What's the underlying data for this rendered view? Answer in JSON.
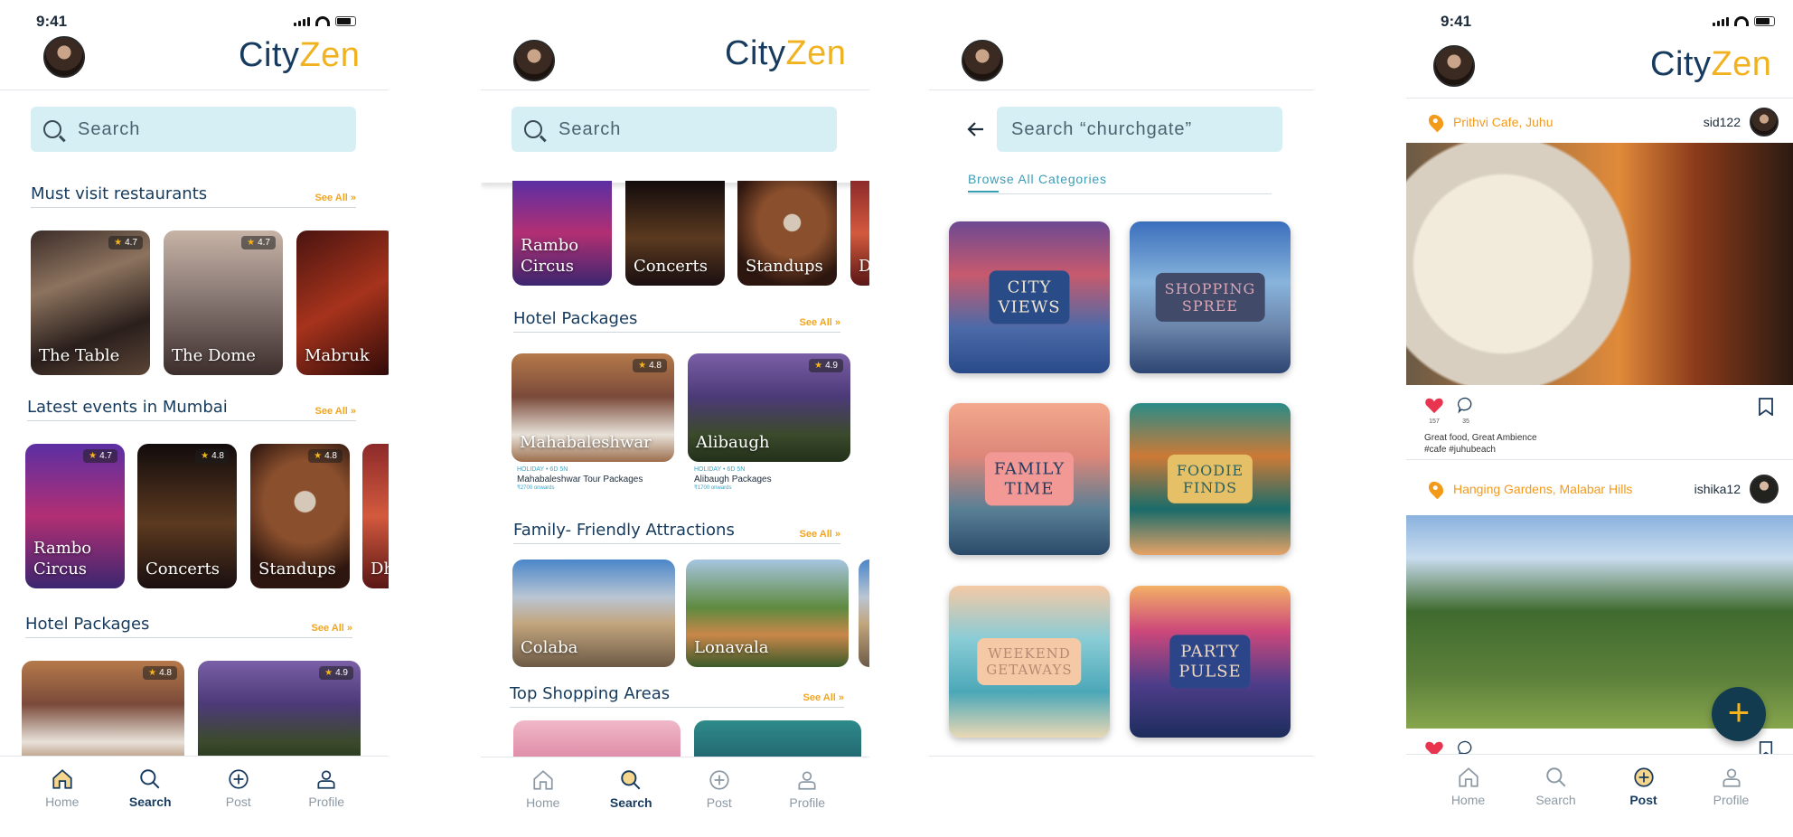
{
  "status_time": "9:41",
  "logo": {
    "part1": "City",
    "part2": "Zen"
  },
  "nav": {
    "home": "Home",
    "search": "Search",
    "post": "Post",
    "profile": "Profile"
  },
  "screen1": {
    "search_placeholder": "Search",
    "section_restaurants": "Must visit restaurants",
    "section_events": "Latest events in Mumbai",
    "section_hotels": "Hotel Packages",
    "see_all": "See All »",
    "restaurants": [
      {
        "name": "The Table",
        "rating": "4.7"
      },
      {
        "name": "The Dome",
        "rating": "4.7"
      },
      {
        "name": "Mabruk",
        "rating": ""
      }
    ],
    "events": [
      {
        "name": "Rambo Circus",
        "rating": "4.7"
      },
      {
        "name": "Concerts",
        "rating": "4.8"
      },
      {
        "name": "Standups",
        "rating": "4.8"
      },
      {
        "name": "Dh",
        "rating": ""
      }
    ],
    "hotels": [
      {
        "rating": "4.8"
      },
      {
        "rating": "4.9"
      }
    ]
  },
  "screen2": {
    "search_placeholder": "Search",
    "events": [
      {
        "name": "Rambo Circus"
      },
      {
        "name": "Concerts"
      },
      {
        "name": "Standups"
      },
      {
        "name": "D"
      }
    ],
    "section_hotels": "Hotel Packages",
    "section_family": "Family- Friendly Attractions",
    "section_shopping": "Top Shopping Areas",
    "see_all": "See All »",
    "hotels": [
      {
        "name": "Mahabaleshwar",
        "rating": "4.8",
        "tag": "HOLIDAY • 6D 5N",
        "title": "Mahabaleshwar Tour Packages",
        "price": "₹2700 onwards"
      },
      {
        "name": "Alibaugh",
        "rating": "4.9",
        "tag": "HOLIDAY • 6D 5N",
        "title": "Alibaugh Packages",
        "price": "₹1700 onwards"
      }
    ],
    "attractions": [
      {
        "name": "Colaba"
      },
      {
        "name": "Lonavala"
      }
    ]
  },
  "screen3": {
    "search_value": "Search “churchgate”",
    "browse_label": "Browse All Categories",
    "categories": [
      {
        "label": "CITY VIEWS"
      },
      {
        "label": "SHOPPING SPREE"
      },
      {
        "label": "FAMILY TIME"
      },
      {
        "label": "FOODIE FINDS"
      },
      {
        "label": "WEEKEND GETAWAYS"
      },
      {
        "label": "PARTY PULSE"
      }
    ]
  },
  "screen4": {
    "posts": [
      {
        "location": "Prithvi Cafe, Juhu",
        "user": "sid122",
        "likes": "157",
        "comments": "35",
        "caption": "Great food, Great Ambience",
        "hashtags": "#cafe #juhubeach"
      },
      {
        "location": "Hanging Gardens, Malabar Hills",
        "user": "ishika12"
      }
    ],
    "fab": "+"
  }
}
